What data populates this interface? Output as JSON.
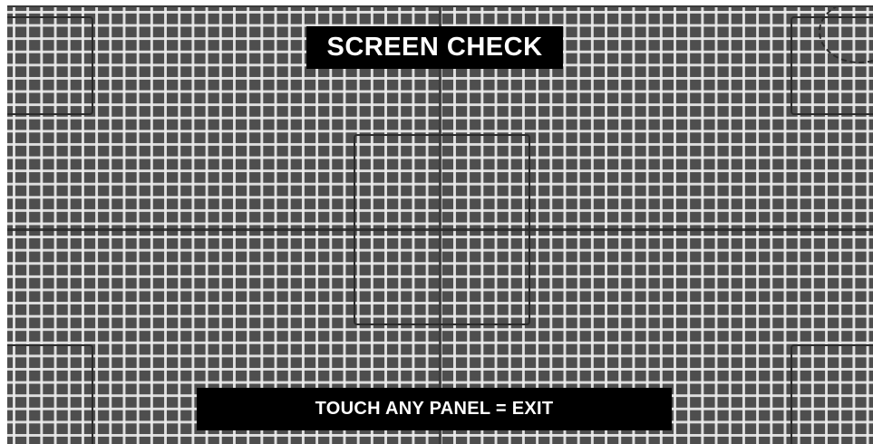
{
  "screen": {
    "title": "SCREEN CHECK",
    "exit_instruction": "TOUCH ANY PANEL = EXIT"
  },
  "colors": {
    "background": "#4e4e4e",
    "grid_lines": "#ebebeb",
    "label_background": "#000000",
    "label_text": "#ffffff",
    "frame_lines": "#2b2b2b"
  }
}
